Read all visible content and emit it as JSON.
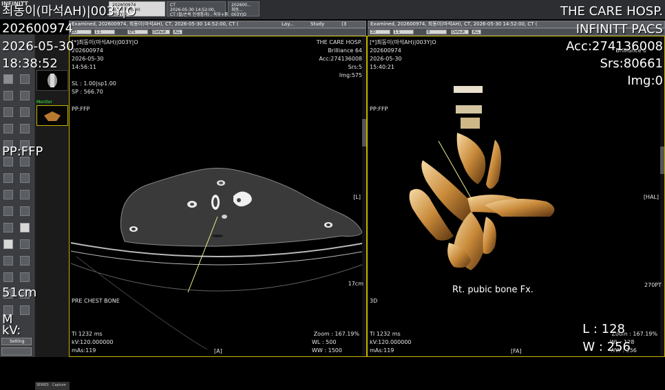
{
  "app": {
    "logo": "INFINITT",
    "hospital": "THE CARE HOSP.",
    "pacs": "INFINITT PACS",
    "accession": "Acc:274136008",
    "series": "Srs:80661",
    "image": "Img:0"
  },
  "overlay_left": {
    "patient_name": "최동이(마석AH)|003Y|O",
    "patient_id": "202600974",
    "date": "2026-05-30",
    "time": "18:38:52",
    "pp": "PP:FFP",
    "size": "51cm",
    "kv": "kV:",
    "m": "M"
  },
  "overlay_right": {
    "l": "L : 128",
    "w": "W : 256"
  },
  "tabs": [
    {
      "line1": "202600974",
      "line2": "최동이(마석AH)",
      "line3": "003Y|O"
    },
    {
      "line1": "CT",
      "line2": "2026-05-30 14:52:00,",
      "line3": "CT (팔/손목 인생통과) : 옥부+흉..."
    },
    {
      "line1": "202600...",
      "line2": "최동...",
      "line3": "003Y|O"
    }
  ],
  "viewport1": {
    "header": "Examined, 202600974, 최동이(마석AH), CT, 2026-05-30 14:52:00, CT (",
    "layout": "Lay...",
    "study": "Study",
    "page": "(3",
    "dropdowns": [
      "2D",
      "1:1",
      "STS",
      "Default",
      "ALL"
    ],
    "name": "[*]최동이(마석AH)|003Y|O",
    "id": "202600974",
    "date": "2026-05-30",
    "time": "14:56:11",
    "sl": "SL : 1.00|sp1.00",
    "sp": "SP : 566.70",
    "pp": "PP:FFP",
    "hospital": "THE CARE HOSP.",
    "model": "Brilliance 64",
    "acc": "Acc:274136008",
    "srs": "Srs:5",
    "img": "Img:575",
    "side_right": "[L]",
    "scale": "17cm",
    "desc": "PRE CHEST BONE",
    "ti": "TI 1232 ms",
    "kv": "kV:120.000000",
    "mas": "mAs:119",
    "zoom": "Zoom : 167.19%",
    "wl": "WL : 500",
    "ww": "WW : 1500",
    "bottom": "[A]"
  },
  "viewport2": {
    "header": "Examined, 202600974, 최동이(마석AH), CT, 2026-05-30 14:52:00, CT (",
    "dropdowns": [
      "2D",
      "1:1",
      "9",
      "Default",
      "ALL"
    ],
    "name": "[*]최동이(마석AH)|003Y|O",
    "id": "202600974",
    "date": "2026-05-30",
    "time": "15:40:21",
    "pp": "PP:FFP",
    "side_right": "[HAL]",
    "annotation": "Rt. pubic bone Fx.",
    "scale": "270PT",
    "mode": "3D",
    "ti": "TI 1232 ms",
    "kv": "kV:120.000000",
    "mas": "mAs:119",
    "zoom": "Zoom : 167.19%",
    "wl": "WL : 128",
    "ww": "WW : 256",
    "bottom": "[FA]",
    "partial_hosp": "Brilliance 6"
  },
  "thumbs": {
    "monitor_label": "Monitor"
  },
  "toolbar": {
    "settings": "Setting"
  },
  "colors": {
    "annotation_arrow": "#f3f08a",
    "viewport_border": "#c7b500",
    "bone": "#c98a3a"
  }
}
